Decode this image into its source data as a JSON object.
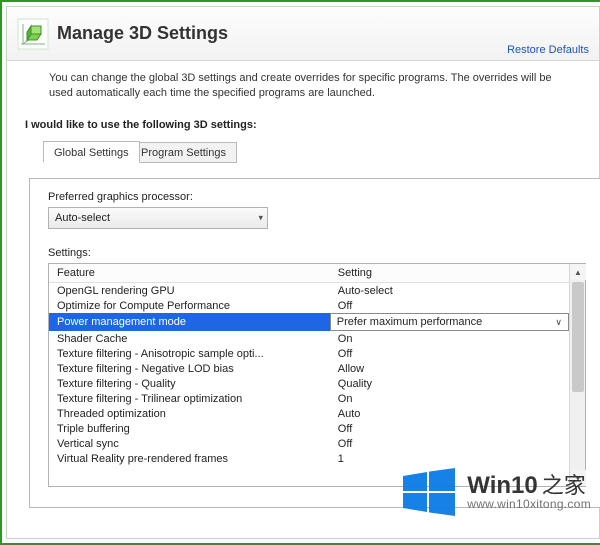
{
  "header": {
    "title": "Manage 3D Settings",
    "restore_link": "Restore Defaults"
  },
  "description": "You can change the global 3D settings and create overrides for specific programs. The overrides will be used automatically each time the specified programs are launched.",
  "section_heading": "I would like to use the following 3D settings:",
  "tabs": {
    "global": "Global Settings",
    "program": "Program Settings"
  },
  "preferred_processor": {
    "label": "Preferred graphics processor:",
    "value": "Auto-select"
  },
  "settings_label": "Settings:",
  "settings_table": {
    "col_feature": "Feature",
    "col_setting": "Setting",
    "rows": [
      {
        "feature": "OpenGL rendering GPU",
        "setting": "Auto-select",
        "selected": false
      },
      {
        "feature": "Optimize for Compute Performance",
        "setting": "Off",
        "selected": false
      },
      {
        "feature": "Power management mode",
        "setting": "Prefer maximum performance",
        "selected": true
      },
      {
        "feature": "Shader Cache",
        "setting": "On",
        "selected": false
      },
      {
        "feature": "Texture filtering - Anisotropic sample opti...",
        "setting": "Off",
        "selected": false
      },
      {
        "feature": "Texture filtering - Negative LOD bias",
        "setting": "Allow",
        "selected": false
      },
      {
        "feature": "Texture filtering - Quality",
        "setting": "Quality",
        "selected": false
      },
      {
        "feature": "Texture filtering - Trilinear optimization",
        "setting": "On",
        "selected": false
      },
      {
        "feature": "Threaded optimization",
        "setting": "Auto",
        "selected": false
      },
      {
        "feature": "Triple buffering",
        "setting": "Off",
        "selected": false
      },
      {
        "feature": "Vertical sync",
        "setting": "Off",
        "selected": false
      },
      {
        "feature": "Virtual Reality pre-rendered frames",
        "setting": "1",
        "selected": false
      }
    ]
  },
  "watermark": {
    "brand_main": "Win10",
    "brand_sub": "之家",
    "url": "www.win10xitong.com"
  }
}
